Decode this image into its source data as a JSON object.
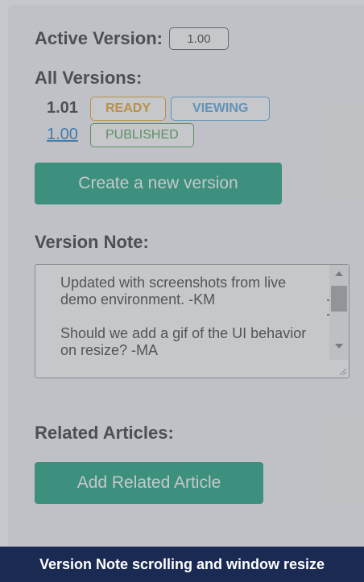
{
  "panel": {
    "active_version_label": "Active Version:",
    "active_version_value": "1.00",
    "all_versions_label": "All Versions:",
    "versions": [
      {
        "number": "1.01",
        "badges": [
          "READY",
          "VIEWING"
        ]
      },
      {
        "number": "1.00",
        "badges": [
          "PUBLISHED"
        ]
      }
    ],
    "create_button_label": "Create a new version",
    "version_note_label": "Version Note:",
    "version_note_text": "Updated with screenshots from live demo environment. -KM\n\nShould we add a gif of the UI behavior on resize? -MA",
    "related_articles_label": "Related Articles:",
    "add_related_button_label": "Add Related Article"
  },
  "caption": "Version Note scrolling and window resize",
  "colors": {
    "primary_button": "#14a07a",
    "ready": "#e8a21c",
    "viewing": "#52a6dd",
    "published": "#4a9e4a",
    "link": "#1d7fc7",
    "caption_bg": "#1a2a52"
  },
  "icons": {
    "scroll_up": "scroll-up-arrow-icon",
    "scroll_down": "scroll-down-arrow-icon",
    "text_cursor": "i-beam-cursor-icon",
    "resize_grip": "resize-grip-icon"
  }
}
